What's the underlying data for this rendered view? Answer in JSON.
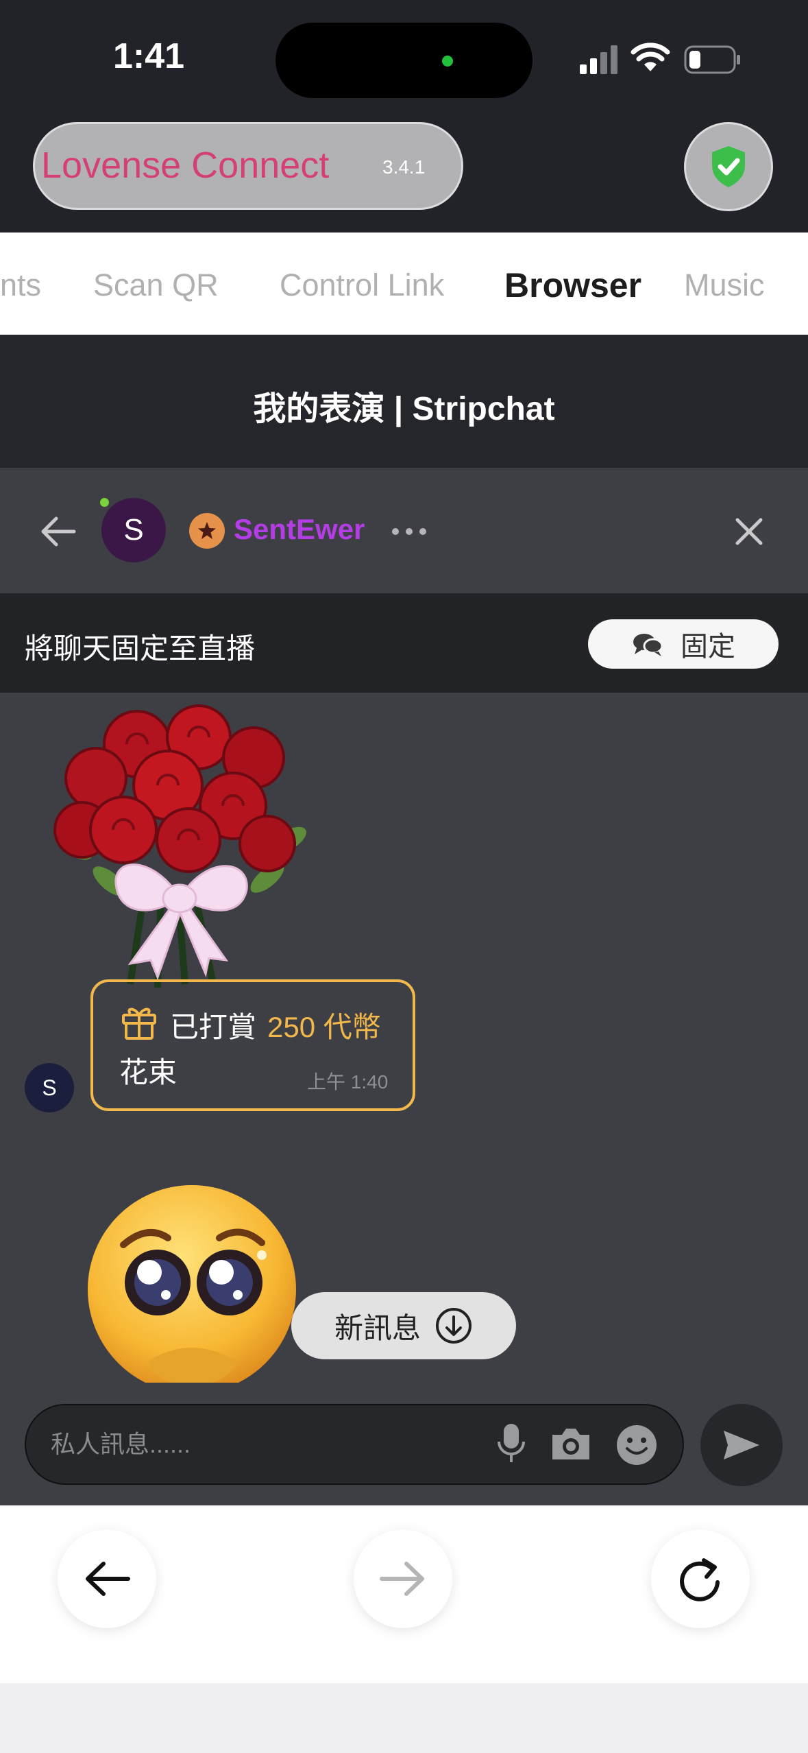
{
  "status_bar": {
    "time": "1:41"
  },
  "app": {
    "name": "Lovense Connect",
    "version": "3.4.1"
  },
  "tabs": [
    {
      "label": "nts"
    },
    {
      "label": "Scan QR"
    },
    {
      "label": "Control Link"
    },
    {
      "label": "Browser",
      "active": true
    },
    {
      "label": "Music"
    }
  ],
  "page": {
    "title": "我的表演 | Stripchat"
  },
  "chat_header": {
    "avatar_letter": "S",
    "username": "SentEwer"
  },
  "pin_bar": {
    "text": "將聊天固定至直播",
    "button_label": "固定"
  },
  "gift_message": {
    "prefix": "已打賞",
    "amount": "250 代幣",
    "item": "花束",
    "time": "上午 1:40",
    "sender_letter": "S"
  },
  "new_message_button": "新訊息",
  "input": {
    "placeholder": "私人訊息......",
    "value": ""
  },
  "colors": {
    "brand_pink": "#d53f77",
    "username_purple": "#b43de6",
    "gift_gold": "#f2b84b",
    "shield_green": "#3dbe4a"
  },
  "icons": [
    "shield-check-icon",
    "back-arrow-icon",
    "more-icon",
    "close-icon",
    "star-badge-icon",
    "chat-pin-icon",
    "gift-icon",
    "arrow-down-circle-icon",
    "mic-icon",
    "camera-icon",
    "emoji-icon",
    "send-icon",
    "nav-back-icon",
    "nav-forward-icon",
    "reload-icon"
  ]
}
